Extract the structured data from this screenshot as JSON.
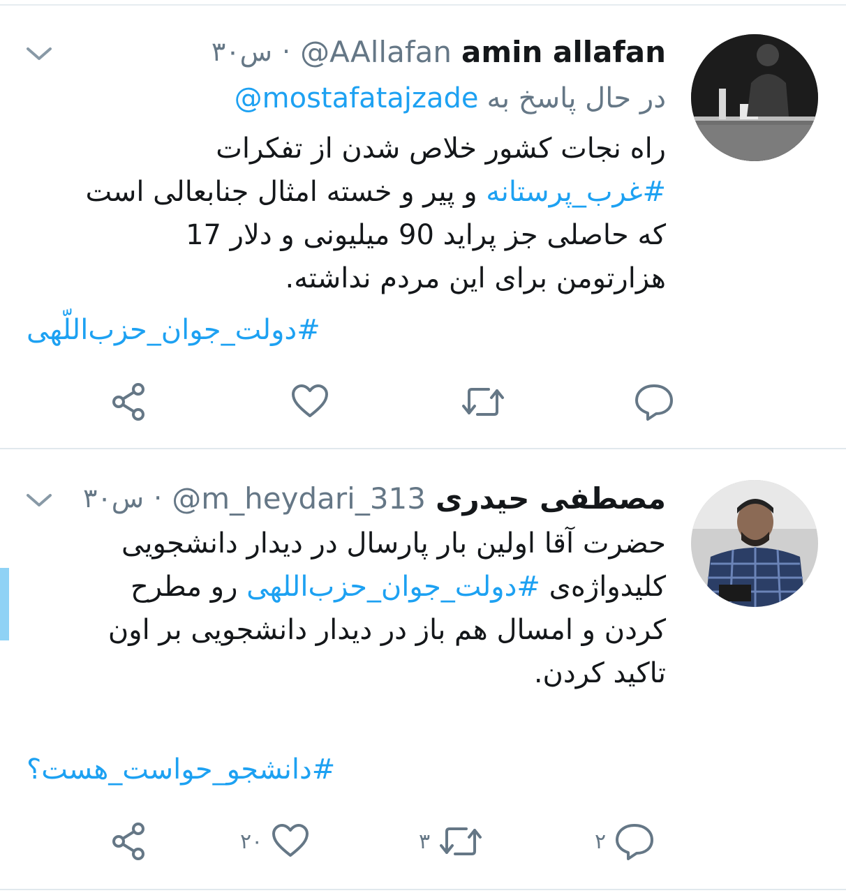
{
  "tweets": [
    {
      "name": "amin allafan",
      "handle": "@AAllafan",
      "time": "۳۰س",
      "dot": "·",
      "reply_label": "در حال پاسخ به",
      "reply_mention": "@mostafatajzade",
      "body_lines": [
        "راه نجات کشور خلاص شدن از تفکرات",
        "#غرب_پرستانه",
        "و پیر و خسته امثال جنابعالی است",
        "که حاصلی جز پراید 90 میلیونی و دلار 17",
        "هزارتومن برای این مردم نداشته."
      ],
      "trailing_tag": "#دولت_جوان_حزب‌اللّهی",
      "actions": {
        "reply_count": "",
        "retweet_count": "",
        "like_count": ""
      },
      "icons": [
        "chevron-down-icon",
        "avatar",
        "reply-icon",
        "retweet-icon",
        "like-icon",
        "share-icon"
      ]
    },
    {
      "name": "مصطفی حیدری",
      "handle": "@m_heydari_313",
      "time": "۳۰س",
      "dot": "·",
      "body_lines": [
        "حضرت آقا اولین بار پارسال در دیدار دانشجویی",
        "کلیدواژه‌ی",
        "#دولت_جوان_حزب‌اللهی",
        "رو مطرح",
        "کردن و امسال هم باز در دیدار دانشجویی بر اون",
        "تاکید کردن."
      ],
      "trailing_tag": "#دانشجو_حواست_هست؟",
      "actions": {
        "reply_count": "۲",
        "retweet_count": "۳",
        "like_count": "۲۰"
      },
      "icons": [
        "chevron-down-icon",
        "avatar",
        "reply-icon",
        "retweet-icon",
        "like-icon",
        "share-icon"
      ]
    }
  ],
  "colors": {
    "link": "#1da1f2",
    "secondary": "#657786",
    "text": "#14171a",
    "divider": "#e1e8ed"
  }
}
